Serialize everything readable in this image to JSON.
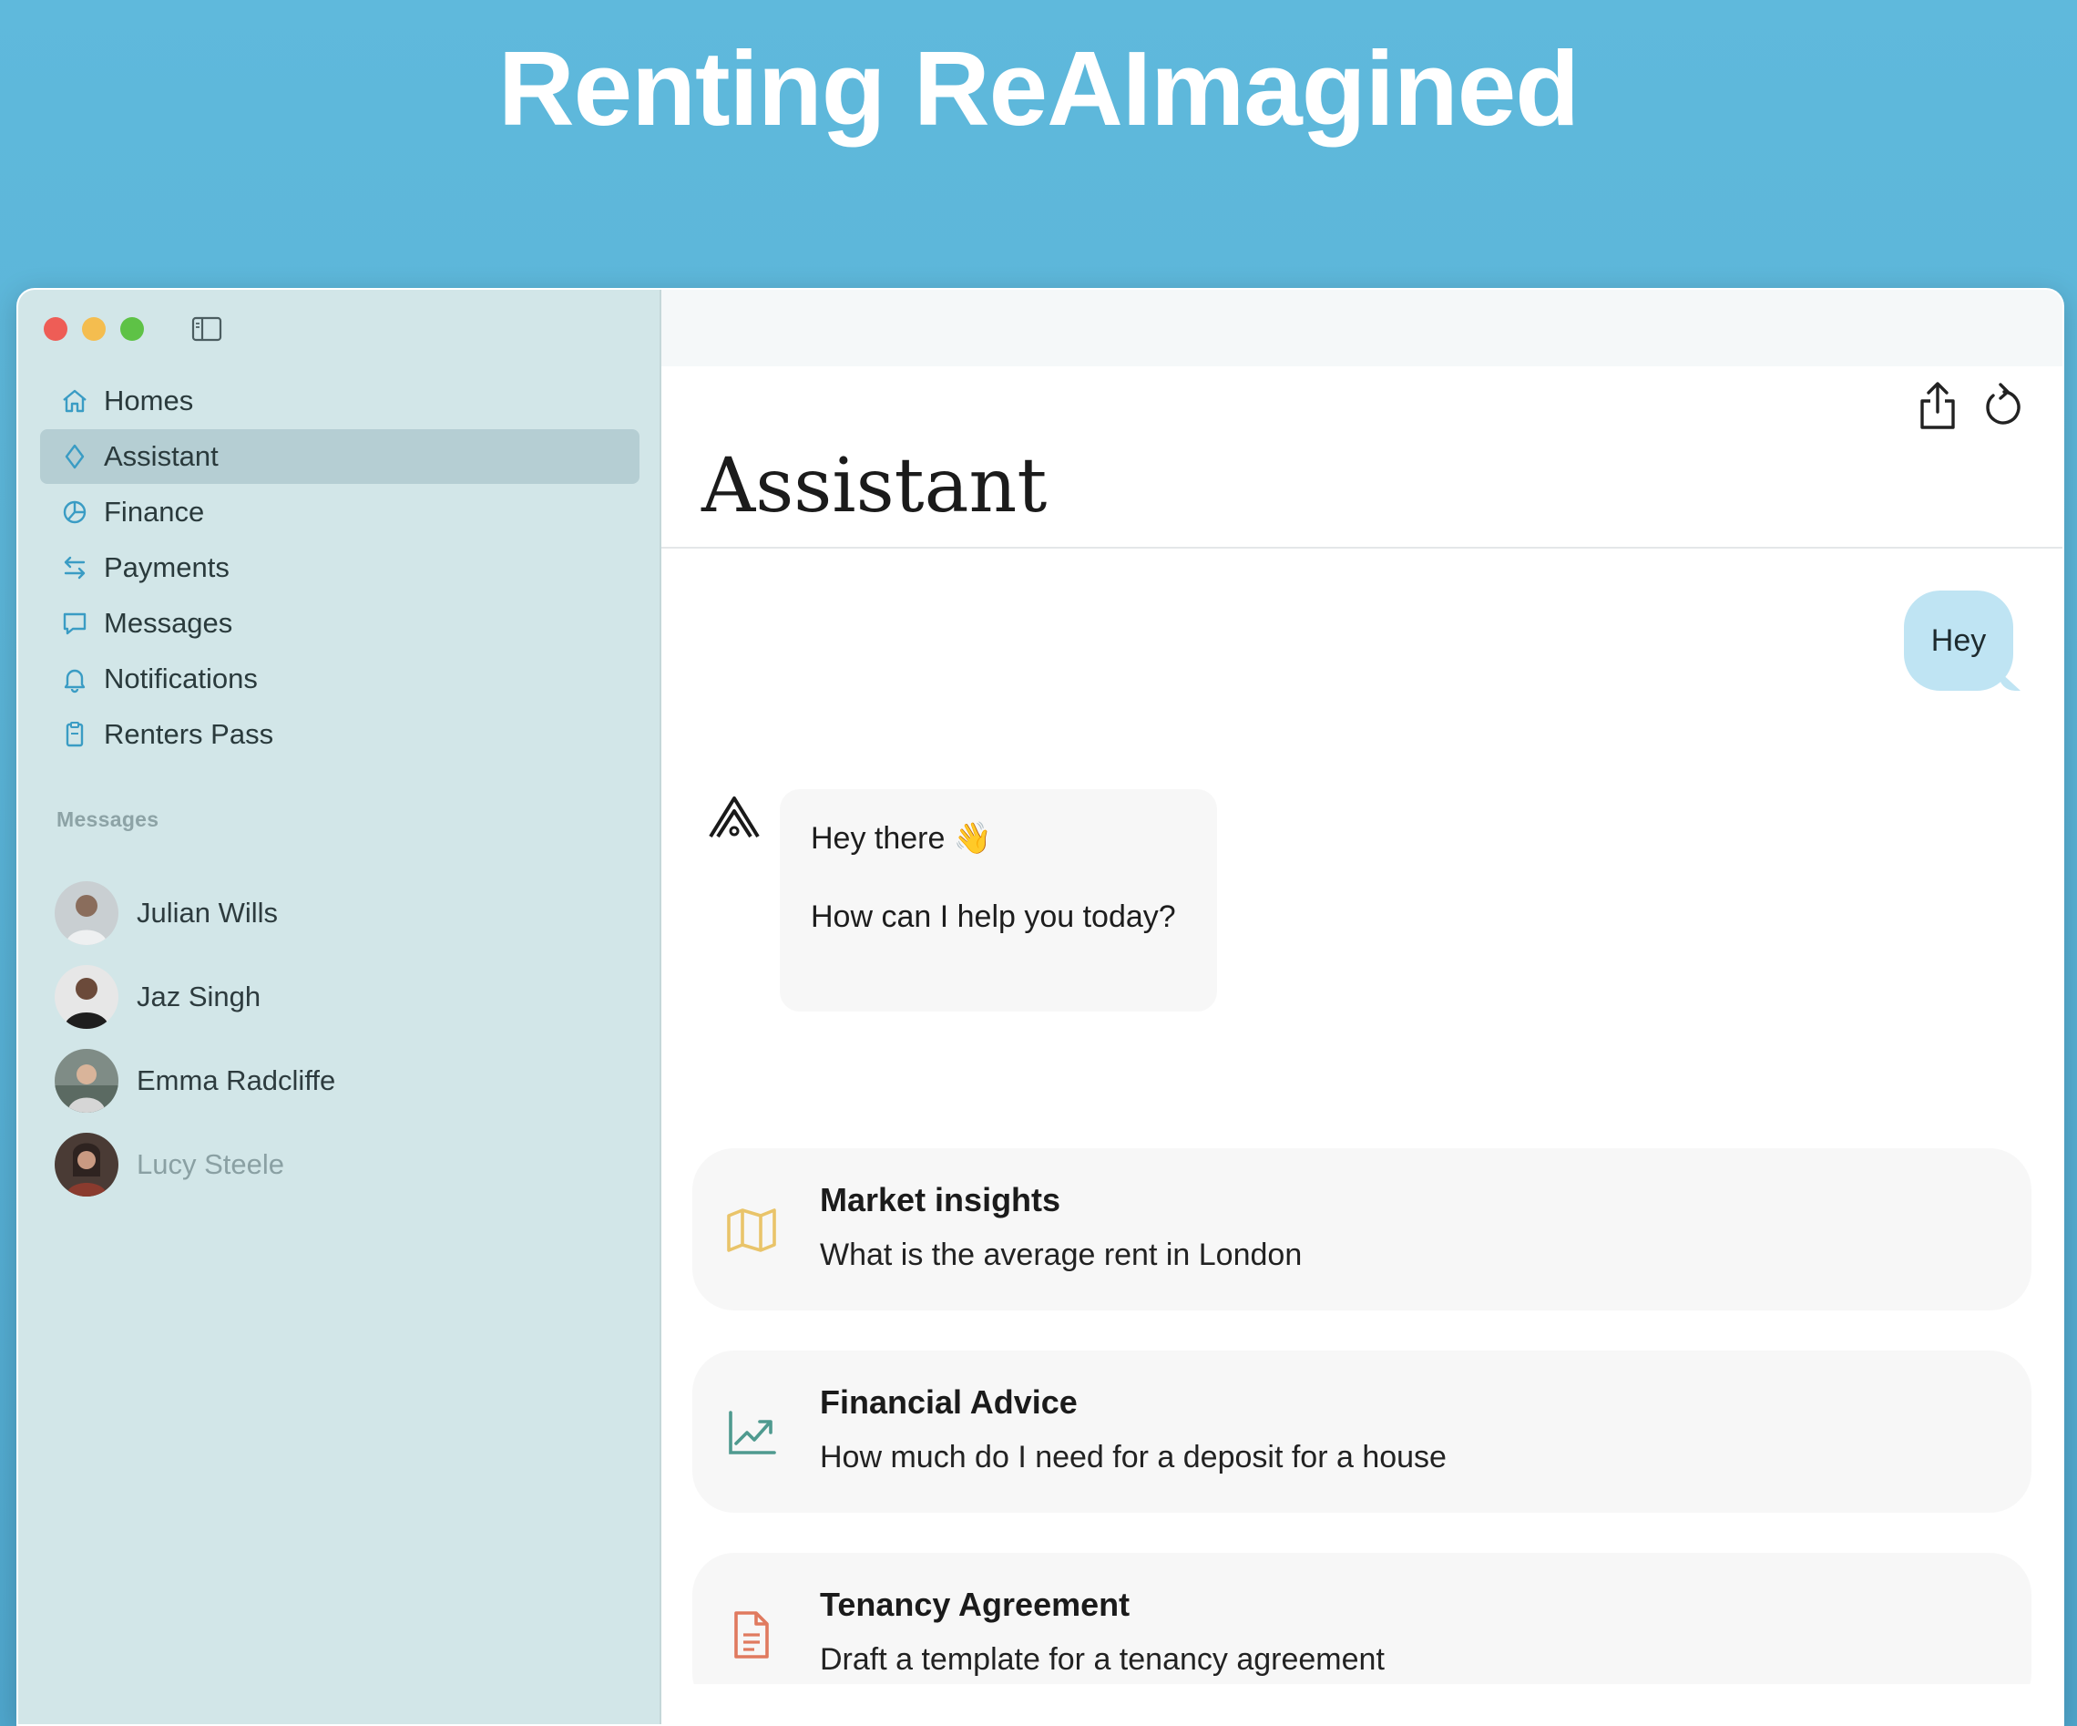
{
  "headline": "Renting ReAImagined",
  "sidebar": {
    "items": [
      {
        "label": "Homes",
        "icon": "home-icon"
      },
      {
        "label": "Assistant",
        "icon": "diamond-icon",
        "active": true
      },
      {
        "label": "Finance",
        "icon": "pie-chart-icon"
      },
      {
        "label": "Payments",
        "icon": "transfer-arrows-icon"
      },
      {
        "label": "Messages",
        "icon": "chat-bubble-icon"
      },
      {
        "label": "Notifications",
        "icon": "bell-icon"
      },
      {
        "label": "Renters Pass",
        "icon": "clipboard-icon"
      }
    ],
    "section_label": "Messages",
    "contacts": [
      {
        "name": "Julian Wills"
      },
      {
        "name": "Jaz Singh"
      },
      {
        "name": "Emma Radcliffe"
      },
      {
        "name": "Lucy Steele"
      }
    ]
  },
  "main": {
    "title": "Assistant",
    "user_message": "Hey",
    "bot_message": {
      "greeting": "Hey there 👋",
      "question": "How can I help you today?"
    },
    "suggestions": [
      {
        "title": "Market insights",
        "subtitle": "What is the average rent in London",
        "icon": "map-icon",
        "color": "#e9c46a"
      },
      {
        "title": "Financial Advice",
        "subtitle": "How much do I need for a deposit for a house",
        "icon": "trending-chart-icon",
        "color": "#4f9a8f"
      },
      {
        "title": "Tenancy Agreement",
        "subtitle": "Draft a template for a tenancy agreement",
        "icon": "document-icon",
        "color": "#e07a5f"
      }
    ]
  },
  "colors": {
    "accent": "#3a9cc4",
    "sidebar_bg": "#d2e6e8",
    "active_item_bg": "#b5ced3",
    "user_bubble": "#bfe4f3"
  }
}
